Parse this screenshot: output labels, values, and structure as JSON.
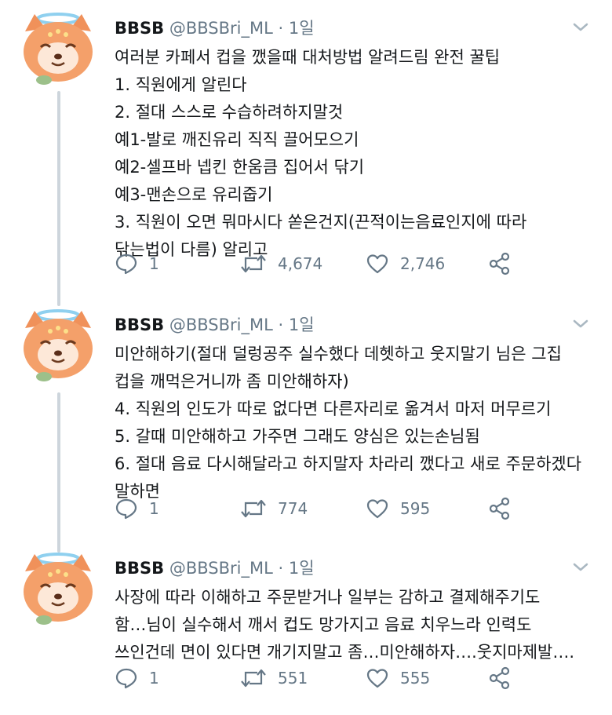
{
  "theme": {
    "text": "#14171a",
    "secondary": "#657786",
    "thread_line": "#cdd5dc",
    "icon": "#657786",
    "avatar_fur": "#f0915a",
    "avatar_halo": "#8fd0ef"
  },
  "icons": {
    "reply": "comment-bubble-icon",
    "retweet": "retweet-arrows-icon",
    "like": "heart-icon",
    "share": "share-nodes-icon",
    "more": "chevron-down-icon"
  },
  "tweets": [
    {
      "name": "BBSB",
      "handle": "@BBSBri_ML",
      "sep": "·",
      "time": "1일",
      "lines": [
        "여러분 카페서 컵을 깼을때 대처방법 알려드림 완전 꿀팁",
        "1. 직원에게 알린다",
        "2. 절대 스스로 수습하려하지말것",
        "예1-발로 깨진유리 직직 끌어모으기",
        "예2-셀프바 넵킨 한움큼 집어서 닦기",
        "예3-맨손으로 유리줍기",
        "3. 직원이 오면 뭐마시다 쏟은건지(끈적이는음료인지에 따라",
        "닦는법이 다름) 알리고"
      ],
      "replies": "1",
      "retweets": "4,674",
      "likes": "2,746"
    },
    {
      "name": "BBSB",
      "handle": "@BBSBri_ML",
      "sep": "·",
      "time": "1일",
      "lines": [
        "미안해하기(절대 덜렁공주 실수했다 데헷하고 웃지말기 님은 그집",
        "컵을 깨먹은거니까 좀 미안해하자)",
        "4. 직원의 인도가 따로 없다면 다른자리로 옮겨서 마저 머무르기",
        "5. 갈때 미안해하고 가주면 그래도 양심은 있는손님됨",
        "6. 절대 음료 다시해달라고 하지말자 차라리 깼다고 새로 주문하겠다",
        "말하면"
      ],
      "replies": "1",
      "retweets": "774",
      "likes": "595"
    },
    {
      "name": "BBSB",
      "handle": "@BBSBri_ML",
      "sep": "·",
      "time": "1일",
      "lines": [
        "사장에 따라 이해하고 주문받거나 일부는 감하고 결제해주기도",
        "함…님이 실수해서 깨서 컵도 망가지고 음료 치우느라 인력도",
        "쓰인건데 면이 있다면 개기지말고 좀…미안해하자….웃지마제발…."
      ],
      "replies": "1",
      "retweets": "551",
      "likes": "555"
    }
  ]
}
